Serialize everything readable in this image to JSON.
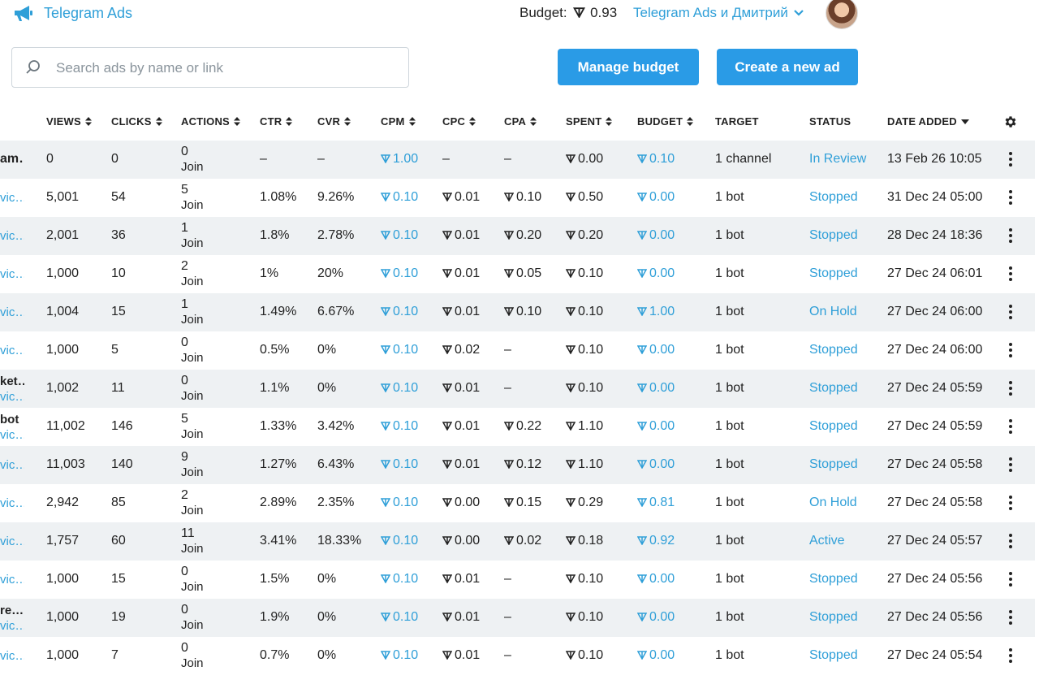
{
  "brand": {
    "name": "Telegram Ads"
  },
  "header": {
    "budget_label": "Budget:",
    "budget_value": "0.93",
    "account": "Telegram Ads и Дмитрий"
  },
  "search": {
    "placeholder": "Search ads by name or link",
    "value": ""
  },
  "buttons": {
    "manage_budget": "Manage budget",
    "create_ad": "Create a new ad"
  },
  "colors": {
    "accent": "#2f9fd8",
    "button": "#2a9be6",
    "row_alt": "#eef1f3"
  },
  "columns": [
    "VIEWS",
    "CLICKS",
    "ACTIONS",
    "CTR",
    "CVR",
    "CPM",
    "CPC",
    "CPA",
    "SPENT",
    "BUDGET",
    "TARGET",
    "STATUS",
    "DATE ADDED"
  ],
  "rows": [
    {
      "name": "am…",
      "link": "",
      "views": "0",
      "clicks": "0",
      "actions": "0",
      "action_type": "Join",
      "ctr": "–",
      "cvr": "–",
      "cpm": "1.00",
      "cpc": "–",
      "cpa": "–",
      "spent": "0.00",
      "budget": "0.10",
      "target": "1 channel",
      "status": "In Review",
      "date": "13 Feb 26 10:05"
    },
    {
      "name": "",
      "link": "vic…",
      "views": "5,001",
      "clicks": "54",
      "actions": "5",
      "action_type": "Join",
      "ctr": "1.08%",
      "cvr": "9.26%",
      "cpm": "0.10",
      "cpc": "0.01",
      "cpa": "0.10",
      "spent": "0.50",
      "budget": "0.00",
      "target": "1 bot",
      "status": "Stopped",
      "date": "31 Dec 24 05:00"
    },
    {
      "name": "",
      "link": "vic…",
      "views": "2,001",
      "clicks": "36",
      "actions": "1",
      "action_type": "Join",
      "ctr": "1.8%",
      "cvr": "2.78%",
      "cpm": "0.10",
      "cpc": "0.01",
      "cpa": "0.20",
      "spent": "0.20",
      "budget": "0.00",
      "target": "1 bot",
      "status": "Stopped",
      "date": "28 Dec 24 18:36"
    },
    {
      "name": "",
      "link": "vic…",
      "views": "1,000",
      "clicks": "10",
      "actions": "2",
      "action_type": "Join",
      "ctr": "1%",
      "cvr": "20%",
      "cpm": "0.10",
      "cpc": "0.01",
      "cpa": "0.05",
      "spent": "0.10",
      "budget": "0.00",
      "target": "1 bot",
      "status": "Stopped",
      "date": "27 Dec 24 06:01"
    },
    {
      "name": "",
      "link": "vic…",
      "views": "1,004",
      "clicks": "15",
      "actions": "1",
      "action_type": "Join",
      "ctr": "1.49%",
      "cvr": "6.67%",
      "cpm": "0.10",
      "cpc": "0.01",
      "cpa": "0.10",
      "spent": "0.10",
      "budget": "1.00",
      "target": "1 bot",
      "status": "On Hold",
      "date": "27 Dec 24 06:00"
    },
    {
      "name": "",
      "link": "vic…",
      "views": "1,000",
      "clicks": "5",
      "actions": "0",
      "action_type": "Join",
      "ctr": "0.5%",
      "cvr": "0%",
      "cpm": "0.10",
      "cpc": "0.02",
      "cpa": "–",
      "spent": "0.10",
      "budget": "0.00",
      "target": "1 bot",
      "status": "Stopped",
      "date": "27 Dec 24 06:00"
    },
    {
      "name": "ket…",
      "link": "vic…",
      "views": "1,002",
      "clicks": "11",
      "actions": "0",
      "action_type": "Join",
      "ctr": "1.1%",
      "cvr": "0%",
      "cpm": "0.10",
      "cpc": "0.01",
      "cpa": "–",
      "spent": "0.10",
      "budget": "0.00",
      "target": "1 bot",
      "status": "Stopped",
      "date": "27 Dec 24 05:59"
    },
    {
      "name": "bot",
      "link": "vic…",
      "views": "11,002",
      "clicks": "146",
      "actions": "5",
      "action_type": "Join",
      "ctr": "1.33%",
      "cvr": "3.42%",
      "cpm": "0.10",
      "cpc": "0.01",
      "cpa": "0.22",
      "spent": "1.10",
      "budget": "0.00",
      "target": "1 bot",
      "status": "Stopped",
      "date": "27 Dec 24 05:59"
    },
    {
      "name": "",
      "link": "vic…",
      "views": "11,003",
      "clicks": "140",
      "actions": "9",
      "action_type": "Join",
      "ctr": "1.27%",
      "cvr": "6.43%",
      "cpm": "0.10",
      "cpc": "0.01",
      "cpa": "0.12",
      "spent": "1.10",
      "budget": "0.00",
      "target": "1 bot",
      "status": "Stopped",
      "date": "27 Dec 24 05:58"
    },
    {
      "name": "",
      "link": "vic…",
      "views": "2,942",
      "clicks": "85",
      "actions": "2",
      "action_type": "Join",
      "ctr": "2.89%",
      "cvr": "2.35%",
      "cpm": "0.10",
      "cpc": "0.00",
      "cpa": "0.15",
      "spent": "0.29",
      "budget": "0.81",
      "target": "1 bot",
      "status": "On Hold",
      "date": "27 Dec 24 05:58"
    },
    {
      "name": "",
      "link": "vic…",
      "views": "1,757",
      "clicks": "60",
      "actions": "11",
      "action_type": "Join",
      "ctr": "3.41%",
      "cvr": "18.33%",
      "cpm": "0.10",
      "cpc": "0.00",
      "cpa": "0.02",
      "spent": "0.18",
      "budget": "0.92",
      "target": "1 bot",
      "status": "Active",
      "date": "27 Dec 24 05:57"
    },
    {
      "name": "",
      "link": "vic…",
      "views": "1,000",
      "clicks": "15",
      "actions": "0",
      "action_type": "Join",
      "ctr": "1.5%",
      "cvr": "0%",
      "cpm": "0.10",
      "cpc": "0.01",
      "cpa": "–",
      "spent": "0.10",
      "budget": "0.00",
      "target": "1 bot",
      "status": "Stopped",
      "date": "27 Dec 24 05:56"
    },
    {
      "name": "re…",
      "link": "vic…",
      "views": "1,000",
      "clicks": "19",
      "actions": "0",
      "action_type": "Join",
      "ctr": "1.9%",
      "cvr": "0%",
      "cpm": "0.10",
      "cpc": "0.01",
      "cpa": "–",
      "spent": "0.10",
      "budget": "0.00",
      "target": "1 bot",
      "status": "Stopped",
      "date": "27 Dec 24 05:56"
    },
    {
      "name": "",
      "link": "vic…",
      "views": "1,000",
      "clicks": "7",
      "actions": "0",
      "action_type": "Join",
      "ctr": "0.7%",
      "cvr": "0%",
      "cpm": "0.10",
      "cpc": "0.01",
      "cpa": "–",
      "spent": "0.10",
      "budget": "0.00",
      "target": "1 bot",
      "status": "Stopped",
      "date": "27 Dec 24 05:54"
    }
  ]
}
